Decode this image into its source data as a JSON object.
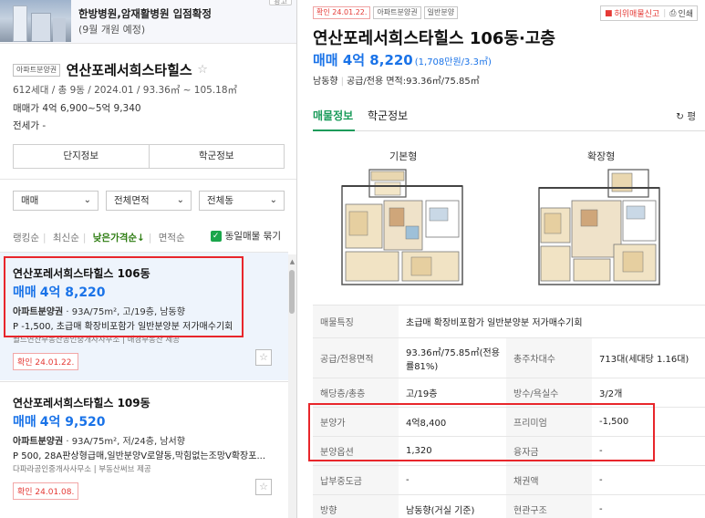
{
  "banner": {
    "title": "한방병원,암재활병원 입점확정",
    "subtitle": "(9월 개원 예정)",
    "ad": "광고"
  },
  "complex": {
    "tag": "아파트분양권",
    "name": "연산포레서희스타힐스",
    "info": "612세대 / 총 9동 / 2024.01 / 93.36㎡ ~ 105.18㎡",
    "sale": "매매가 4억 6,900~5억 9,340",
    "jeonse": "전세가 -"
  },
  "complex_tabs": [
    "단지정보",
    "학군정보"
  ],
  "filters": [
    "매매",
    "전체면적",
    "전체동"
  ],
  "sort": {
    "options": [
      "랭킹순",
      "최신순",
      "낮은가격순↓",
      "면적순"
    ],
    "active_index": 2,
    "same_listing": "동일매물 묶기"
  },
  "listings": [
    {
      "name": "연산포레서희스타힐스 106동",
      "price_type": "매매",
      "price": "4억 8,220",
      "spec_bold": "아파트분양권",
      "spec": " · 93A/75m², 고/19층, 남동향",
      "desc": "P -1,500, 초급매 확장비포함가 일반분양분 저가매수기회",
      "agent": "월드연산부동산공인중개사사무소 | 매경부동산 제공",
      "confirm": "확인 24.01.22."
    },
    {
      "name": "연산포레서희스타힐스 109동",
      "price_type": "매매",
      "price": "4억 9,520",
      "spec_bold": "아파트분양권",
      "spec": " · 93A/75m², 저/24층, 남서향",
      "desc": "P 500, 28A판상형급매,일반분양V로얄동,막힘없는조망V확장포...",
      "agent": "다파라공인중개사사무소 | 부동산써브 제공",
      "confirm": "확인 24.01.08."
    }
  ],
  "detail": {
    "tags": [
      "확인 24.01.22.",
      "아파트분양권",
      "일반분양"
    ],
    "report": "허위매물신고",
    "print": "인쇄",
    "title": "연산포레서희스타힐스 106동·고층",
    "price_type": "매매",
    "price": "4억 8,220",
    "per_m2": "(1,708만원/3.3㎡)",
    "direction": "남동향",
    "area": "공급/전용 면적:93.36㎡/75.85㎡",
    "tabs": [
      "매물정보",
      "학군정보"
    ],
    "refresh": "평",
    "plans": [
      "기본형",
      "확장형"
    ],
    "rows": {
      "feature_label": "매물특징",
      "feature": "초급매 확장비포함가 일반분양분 저가매수기회",
      "area_label": "공급/전용면적",
      "area": "93.36㎡/75.85㎡(전용률81%)",
      "households_label": "총주차대수",
      "households": "713대(세대당 1.16대)",
      "floor_label": "해당층/총층",
      "floor": "고/19층",
      "rooms_label": "방수/욕실수",
      "rooms": "3/2개",
      "presale_label": "분양가",
      "presale": "4억8,400",
      "premium_label": "프리미엄",
      "premium": "-1,500",
      "option_label": "분양옵션",
      "option": "1,320",
      "loan_label": "융자금",
      "loan": "-",
      "paid_label": "납부중도금",
      "paid": "-",
      "bond_label": "채권액",
      "bond": "-",
      "dir_label": "방향",
      "dir": "남동향(거실 기준)",
      "entrance_label": "현관구조",
      "entrance": "-"
    }
  }
}
